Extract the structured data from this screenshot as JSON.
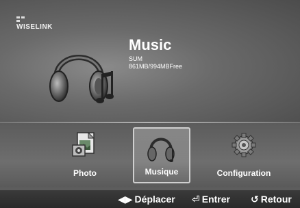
{
  "brand": {
    "logo_text": "WISELINK"
  },
  "header": {
    "title": "Music",
    "device": "SUM",
    "storage": "861MB/994MBFree"
  },
  "menu": {
    "items": [
      {
        "label": "Photo",
        "icon": "photo-icon",
        "selected": false
      },
      {
        "label": "Musique",
        "icon": "headphones-icon",
        "selected": true
      },
      {
        "label": "Configuration",
        "icon": "gear-icon",
        "selected": false
      }
    ]
  },
  "footer": {
    "move": {
      "symbol": "◀▶",
      "label": "Déplacer"
    },
    "enter": {
      "symbol": "⏎",
      "label": "Entrer"
    },
    "back": {
      "symbol": "↺",
      "label": "Retour"
    }
  }
}
